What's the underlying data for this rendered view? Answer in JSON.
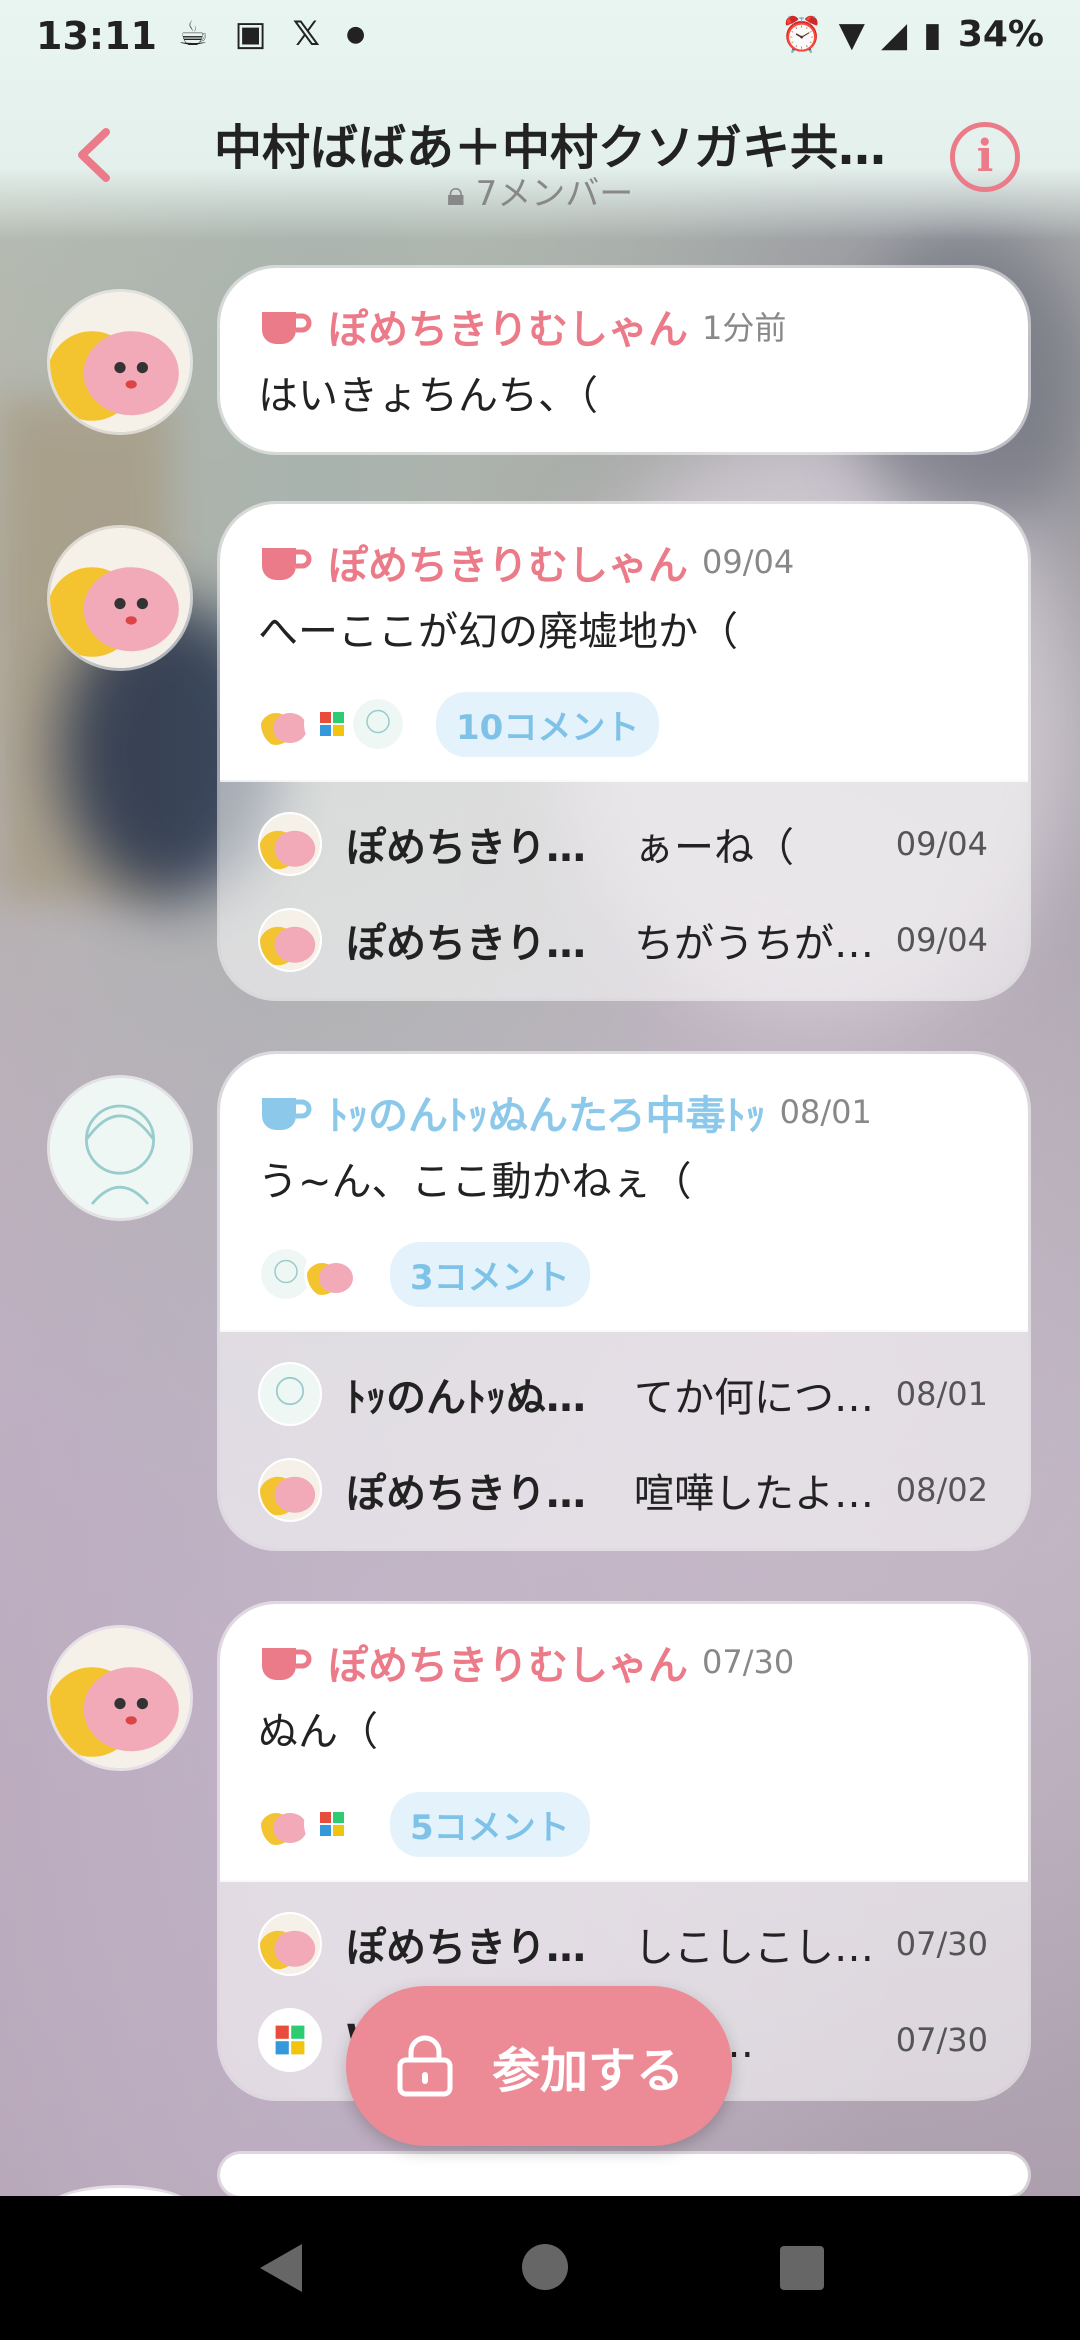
{
  "status_bar": {
    "time": "13:11",
    "left_icons": [
      "cup-icon",
      "app-icon",
      "x-logo-icon",
      "dot-icon"
    ],
    "right_icons": [
      "alarm-icon",
      "wifi-icon",
      "signal-icon",
      "battery-icon"
    ],
    "battery": "34%"
  },
  "header": {
    "title": "中村ばばあ＋中村クソガキ共…",
    "members": "7メンバー"
  },
  "colors": {
    "accent": "#ec7b8a",
    "blue_accent": "#8cc8ea",
    "join_button": "#ec8a96"
  },
  "posts": [
    {
      "author": "ぽめちきりむしゃん",
      "author_color": "pink",
      "time": "1分前",
      "text": "はいきょちんち、（"
    },
    {
      "author": "ぽめちきりむしゃん",
      "author_color": "pink",
      "time": "09/04",
      "text": "へーここが幻の廃墟地か（",
      "comments": "10コメント",
      "replies": [
        {
          "name": "ぽめちきり…",
          "text": "ぁーね（",
          "time": "09/04"
        },
        {
          "name": "ぽめちきり…",
          "text": "ちがうちが…",
          "time": "09/04"
        }
      ]
    },
    {
      "author": "ﾄｯのんﾄｯぬんたろ中毒ﾄｯ",
      "author_color": "blue",
      "time": "08/01",
      "text": "う~ん、ここ動かねぇ（",
      "comments": "3コメント",
      "replies": [
        {
          "name": "ﾄｯのんﾄｯぬ…",
          "text": "てか何につ…",
          "time": "08/01"
        },
        {
          "name": "ぽめちきり…",
          "text": "喧嘩したよ…",
          "time": "08/02"
        }
      ]
    },
    {
      "author": "ぽめちきりむしゃん",
      "author_color": "pink",
      "time": "07/30",
      "text": "ぬん（",
      "comments": "5コメント",
      "replies": [
        {
          "name": "ぽめちきり…",
          "text": "しこしこし…",
          "time": "07/30"
        },
        {
          "name": "W",
          "text": "ぱん…",
          "time": "07/30"
        }
      ]
    }
  ],
  "join_button": {
    "label": "参加する"
  }
}
